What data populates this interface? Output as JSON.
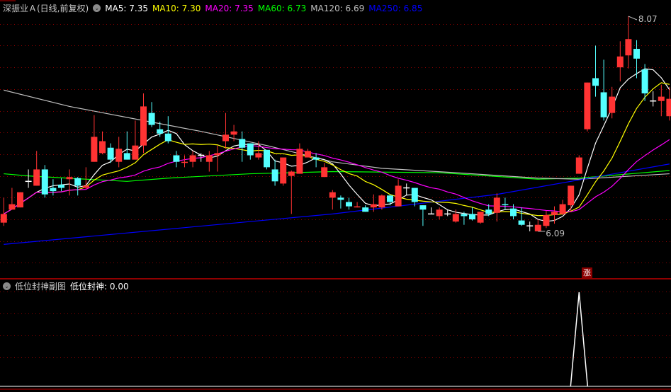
{
  "header": {
    "title": "深振业Ａ(日线,前复权)",
    "ma": [
      {
        "label": "MA5: 7.35",
        "color": "#ffffff"
      },
      {
        "label": "MA10: 7.30",
        "color": "#ffff00"
      },
      {
        "label": "MA20: 7.35",
        "color": "#ff00ff"
      },
      {
        "label": "MA60: 6.73",
        "color": "#00ff00"
      },
      {
        "label": "MA120: 6.69",
        "color": "#c0c0c0"
      },
      {
        "label": "MA250: 6.85",
        "color": "#0000ff"
      }
    ]
  },
  "sub_panel": {
    "title": "低位封神副图",
    "indicator": "低位封神: 0.00"
  },
  "annotations": {
    "high": "8.07",
    "low": "6.09",
    "signal": "涨"
  },
  "colors": {
    "up": "#ff3333",
    "down": "#54ffff",
    "doji": "#ffffff",
    "grid": "#8b0000",
    "border": "#c00000"
  },
  "chart_data": {
    "type": "candlestick",
    "ylim": [
      5.9,
      8.1
    ],
    "grid_levels": [
      8.0,
      7.8,
      7.6,
      7.4,
      7.2,
      7.0,
      6.8,
      6.6,
      6.4,
      6.2,
      6.0,
      5.8
    ],
    "ohlc": [
      [
        6.17,
        6.4,
        6.14,
        6.25
      ],
      [
        6.29,
        6.49,
        6.29,
        6.34
      ],
      [
        6.31,
        6.45,
        6.31,
        6.45
      ],
      [
        6.55,
        6.66,
        6.49,
        6.55
      ],
      [
        6.51,
        6.83,
        6.51,
        6.66
      ],
      [
        6.66,
        6.7,
        6.4,
        6.43
      ],
      [
        6.49,
        6.57,
        6.42,
        6.46
      ],
      [
        6.52,
        6.58,
        6.46,
        6.49
      ],
      [
        6.57,
        6.66,
        6.42,
        6.59
      ],
      [
        6.58,
        6.59,
        6.42,
        6.51
      ],
      [
        6.49,
        6.68,
        6.48,
        6.51
      ],
      [
        6.73,
        7.16,
        6.73,
        6.96
      ],
      [
        6.81,
        7.01,
        6.8,
        6.92
      ],
      [
        6.86,
        6.9,
        6.72,
        6.75
      ],
      [
        6.73,
        6.96,
        6.68,
        6.85
      ],
      [
        6.81,
        7.01,
        6.75,
        6.75
      ],
      [
        6.75,
        7.11,
        6.75,
        6.88
      ],
      [
        6.88,
        7.36,
        6.81,
        7.24
      ],
      [
        7.18,
        7.28,
        7.05,
        7.07
      ],
      [
        7.03,
        7.1,
        6.96,
        6.99
      ],
      [
        6.99,
        7.15,
        6.9,
        6.92
      ],
      [
        6.79,
        6.83,
        6.68,
        6.73
      ],
      [
        6.72,
        6.79,
        6.68,
        6.73
      ],
      [
        6.73,
        6.83,
        6.68,
        6.79
      ],
      [
        6.79,
        6.81,
        6.73,
        6.79
      ],
      [
        6.73,
        6.83,
        6.64,
        6.79
      ],
      [
        6.79,
        6.88,
        6.64,
        6.81
      ],
      [
        6.92,
        7.18,
        6.85,
        6.98
      ],
      [
        6.98,
        7.07,
        6.92,
        7.01
      ],
      [
        6.94,
        7.01,
        6.73,
        6.86
      ],
      [
        6.9,
        6.9,
        6.75,
        6.79
      ],
      [
        6.77,
        6.92,
        6.75,
        6.81
      ],
      [
        6.84,
        6.84,
        6.66,
        6.68
      ],
      [
        6.66,
        6.75,
        6.51,
        6.55
      ],
      [
        6.53,
        6.77,
        6.51,
        6.77
      ],
      [
        6.6,
        6.65,
        6.25,
        6.64
      ],
      [
        6.62,
        6.9,
        6.62,
        6.85
      ],
      [
        6.77,
        6.85,
        6.77,
        6.83
      ],
      [
        6.77,
        6.81,
        6.68,
        6.75
      ],
      [
        6.59,
        6.72,
        6.59,
        6.68
      ],
      [
        6.4,
        6.47,
        6.29,
        6.45
      ],
      [
        6.4,
        6.42,
        6.3,
        6.38
      ],
      [
        6.36,
        6.4,
        6.29,
        6.32
      ],
      [
        6.31,
        6.36,
        6.31,
        6.32
      ],
      [
        6.31,
        6.33,
        6.27,
        6.27
      ],
      [
        6.31,
        6.43,
        6.27,
        6.34
      ],
      [
        6.31,
        6.43,
        6.29,
        6.42
      ],
      [
        6.42,
        6.43,
        6.33,
        6.36
      ],
      [
        6.32,
        6.57,
        6.32,
        6.51
      ],
      [
        6.49,
        6.53,
        6.42,
        6.49
      ],
      [
        6.49,
        6.49,
        6.32,
        6.36
      ],
      [
        6.33,
        6.33,
        6.14,
        6.29
      ],
      [
        6.25,
        6.31,
        6.25,
        6.25
      ],
      [
        6.23,
        6.31,
        6.2,
        6.29
      ],
      [
        6.25,
        6.29,
        6.23,
        6.25
      ],
      [
        6.18,
        6.29,
        6.17,
        6.25
      ],
      [
        6.25,
        6.27,
        6.15,
        6.23
      ],
      [
        6.25,
        6.31,
        6.19,
        6.2
      ],
      [
        6.17,
        6.27,
        6.16,
        6.27
      ],
      [
        6.29,
        6.34,
        6.23,
        6.25
      ],
      [
        6.26,
        6.44,
        6.18,
        6.4
      ],
      [
        6.34,
        6.4,
        6.29,
        6.33
      ],
      [
        6.3,
        6.34,
        6.2,
        6.23
      ],
      [
        6.19,
        6.31,
        6.14,
        6.15
      ],
      [
        6.14,
        6.18,
        6.09,
        6.14
      ],
      [
        6.09,
        6.2,
        6.09,
        6.15
      ],
      [
        6.14,
        6.28,
        6.12,
        6.24
      ],
      [
        6.24,
        6.32,
        6.16,
        6.27
      ],
      [
        6.25,
        6.38,
        6.24,
        6.34
      ],
      [
        6.33,
        6.51,
        6.27,
        6.51
      ],
      [
        6.62,
        6.79,
        6.62,
        6.77
      ],
      [
        7.03,
        7.46,
        7.01,
        7.46
      ],
      [
        7.5,
        7.8,
        7.33,
        7.43
      ],
      [
        7.37,
        7.67,
        7.11,
        7.14
      ],
      [
        7.18,
        7.42,
        7.13,
        7.33
      ],
      [
        7.6,
        7.84,
        7.47,
        7.7
      ],
      [
        7.71,
        8.07,
        7.59,
        7.86
      ],
      [
        7.77,
        7.85,
        7.5,
        7.68
      ],
      [
        7.58,
        7.63,
        7.29,
        7.36
      ],
      [
        7.29,
        7.38,
        7.24,
        7.29
      ],
      [
        7.29,
        7.44,
        7.15,
        7.33
      ],
      [
        7.15,
        7.42,
        7.11,
        7.31
      ]
    ],
    "ma_computed": [
      {
        "name": "MA5",
        "period": 5,
        "color": "#ffffff"
      },
      {
        "name": "MA10",
        "period": 10,
        "color": "#ffff00"
      },
      {
        "name": "MA20",
        "period": 20,
        "color": "#ff00ff"
      }
    ],
    "ma_sampled": [
      {
        "name": "MA60",
        "color": "#00ff00",
        "points": [
          [
            0,
            6.62
          ],
          [
            3,
            6.6
          ],
          [
            10,
            6.57
          ],
          [
            15,
            6.55
          ],
          [
            20,
            6.58
          ],
          [
            30,
            6.62
          ],
          [
            40,
            6.64
          ],
          [
            53,
            6.63
          ],
          [
            65,
            6.57
          ],
          [
            70,
            6.58
          ],
          [
            81,
            6.65
          ]
        ]
      },
      {
        "name": "MA120",
        "color": "#c0c0c0",
        "points": [
          [
            0,
            7.39
          ],
          [
            8,
            7.24
          ],
          [
            17,
            7.11
          ],
          [
            24,
            7.01
          ],
          [
            32,
            6.88
          ],
          [
            40,
            6.73
          ],
          [
            46,
            6.67
          ],
          [
            55,
            6.63
          ],
          [
            65,
            6.58
          ],
          [
            70,
            6.57
          ],
          [
            81,
            6.62
          ]
        ]
      },
      {
        "name": "MA250",
        "color": "#0000ff",
        "points": [
          [
            0,
            5.97
          ],
          [
            40,
            6.25
          ],
          [
            60,
            6.43
          ],
          [
            72,
            6.59
          ],
          [
            81,
            6.71
          ]
        ]
      }
    ],
    "signal": {
      "name": "低位封神",
      "ylim": [
        0,
        1
      ],
      "spike_index": 70,
      "value": 1
    },
    "high_index": 76,
    "low_index": 64,
    "mark_index": 71
  }
}
